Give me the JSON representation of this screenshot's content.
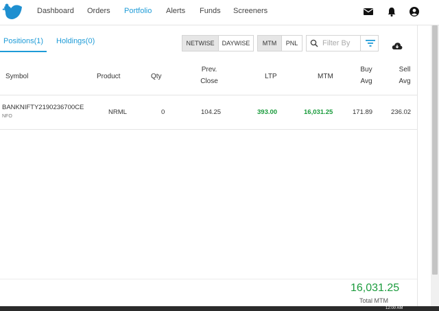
{
  "nav": {
    "items": [
      {
        "label": "Dashboard"
      },
      {
        "label": "Orders"
      },
      {
        "label": "Portfolio"
      },
      {
        "label": "Alerts"
      },
      {
        "label": "Funds"
      },
      {
        "label": "Screeners"
      }
    ],
    "active": "Portfolio",
    "icons": [
      "mail-icon",
      "bell-icon",
      "account-icon"
    ]
  },
  "tabs": {
    "positions": "Positions(1)",
    "holdings": "Holdings(0)"
  },
  "toggles": {
    "netwise": "NETWISE",
    "daywise": "DAYWISE",
    "mtm": "MTM",
    "pnl": "PNL"
  },
  "filter": {
    "placeholder": "Filter By"
  },
  "table": {
    "headers": {
      "symbol": "Symbol",
      "product": "Product",
      "qty": "Qty",
      "prev_close_1": "Prev.",
      "prev_close_2": "Close",
      "ltp": "LTP",
      "mtm": "MTM",
      "buy_avg_1": "Buy",
      "buy_avg_2": "Avg",
      "sell_avg_1": "Sell",
      "sell_avg_2": "Avg"
    },
    "rows": [
      {
        "symbol": "BANKNIFTY2190236700CE",
        "exchange": "NFO",
        "product": "NRML",
        "qty": "0",
        "prev_close": "104.25",
        "ltp": "393.00",
        "mtm": "16,031.25",
        "buy_avg": "171.89",
        "sell_avg": "236.02"
      }
    ]
  },
  "footer": {
    "total_value": "16,031.25",
    "total_label": "Total MTM"
  },
  "colors": {
    "accent": "#1e9bd7",
    "positive": "#1a9b3c"
  },
  "taskbar": {
    "clock": "12:00 AM"
  }
}
